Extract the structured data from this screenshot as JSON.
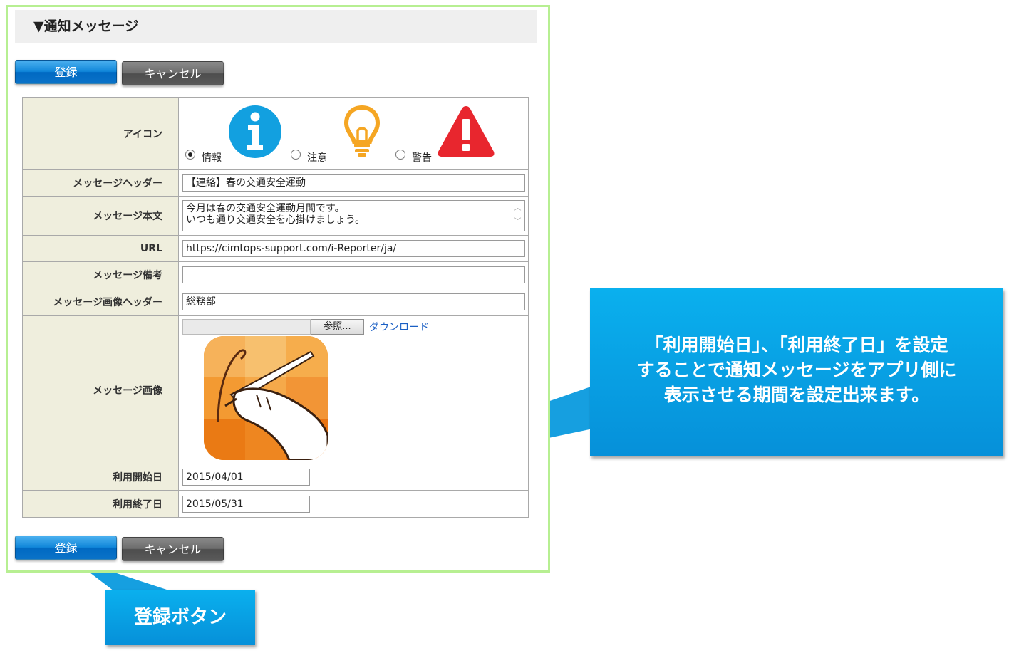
{
  "section": {
    "title": "▼通知メッセージ"
  },
  "buttons": {
    "register": "登録",
    "cancel": "キャンセル"
  },
  "form": {
    "labels": {
      "icon": "アイコン",
      "header": "メッセージヘッダー",
      "body": "メッセージ本文",
      "url": "URL",
      "remarks": "メッセージ備考",
      "image_header": "メッセージ画像ヘッダー",
      "image": "メッセージ画像",
      "start_date": "利用開始日",
      "end_date": "利用終了日"
    },
    "icon_options": [
      {
        "label": "情報",
        "icon": "info-icon",
        "checked": true,
        "color": "#12a0e0"
      },
      {
        "label": "注意",
        "icon": "lightbulb-icon",
        "checked": false,
        "color": "#f5a623"
      },
      {
        "label": "警告",
        "icon": "warning-icon",
        "checked": false,
        "color": "#e8262e"
      }
    ],
    "values": {
      "header": "【連絡】春の交通安全運動",
      "body_line1": "今月は春の交通安全運動月間です。",
      "body_line2": "いつも通り交通安全を心掛けましょう。",
      "url": "https://cimtops-support.com/i-Reporter/ja/",
      "remarks": "",
      "image_header": "総務部",
      "start_date": "2015/04/01",
      "end_date": "2015/05/31"
    },
    "file": {
      "browse_label": "参照...",
      "download_label": "ダウンロード"
    }
  },
  "callouts": {
    "period_line1": "「利用開始日」、「利用終了日」を設定",
    "period_line2": "することで通知メッセージをアプリ側に",
    "period_line3": "表示させる期間を設定出来ます。",
    "register_button": "登録ボタン"
  },
  "colors": {
    "accent_blue": "#0a90d8",
    "panel_border": "#b7ef92",
    "label_bg": "#efeedd"
  }
}
